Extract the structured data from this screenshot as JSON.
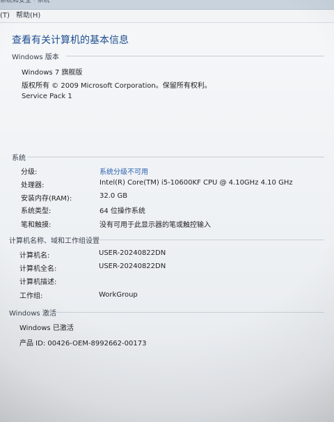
{
  "window": {
    "title_fragment": "系统和安全 · 系统"
  },
  "menubar": {
    "left_fragment": "(T)",
    "help": "帮助(H)"
  },
  "page": {
    "title": "查看有关计算机的基本信息"
  },
  "windows_edition": {
    "header": "Windows 版本",
    "edition": "Windows 7 旗舰版",
    "copyright": "版权所有 © 2009 Microsoft Corporation。保留所有权利。",
    "service_pack": "Service Pack 1"
  },
  "system": {
    "header": "系统",
    "rows": [
      {
        "label": "分级:",
        "value": "系统分级不可用"
      },
      {
        "label": "处理器:",
        "value": "Intel(R) Core(TM) i5-10600KF CPU @ 4.10GHz   4.10 GHz"
      },
      {
        "label": "安装内存(RAM):",
        "value": "32.0 GB"
      },
      {
        "label": "系统类型:",
        "value": "64 位操作系统"
      },
      {
        "label": "笔和触摸:",
        "value": "没有可用于此显示器的笔或触控输入"
      }
    ]
  },
  "computer": {
    "header": "计算机名称、域和工作组设置",
    "rows": [
      {
        "label": "计算机名:",
        "value": "USER-20240822DN"
      },
      {
        "label": "计算机全名:",
        "value": "USER-20240822DN"
      },
      {
        "label": "计算机描述:",
        "value": ""
      },
      {
        "label": "工作组:",
        "value": "WorkGroup"
      }
    ]
  },
  "activation": {
    "header": "Windows 激活",
    "status": "Windows 已激活",
    "product_id": "产品 ID: 00426-OEM-8992662-00173"
  },
  "colors": {
    "title": "#1f4f90",
    "link": "#2c63b1",
    "text": "#222222"
  }
}
